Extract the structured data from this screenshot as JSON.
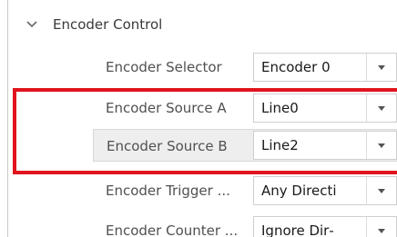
{
  "section": {
    "title": "Encoder Control",
    "expanded": true
  },
  "rows": [
    {
      "label": "Encoder Selector",
      "value": "Encoder 0"
    },
    {
      "label": "Encoder Source A",
      "value": "Line0"
    },
    {
      "label": "Encoder Source B",
      "value": "Line2"
    },
    {
      "label": "Encoder Trigger ...",
      "value": "Any Directi"
    },
    {
      "label": "Encoder Counter ...",
      "value": "Ignore Dir‐"
    }
  ],
  "icons": {
    "expand": "chevron-down-icon",
    "dropdown": "dropdown-caret-icon"
  },
  "colors": {
    "highlight_box": "#e0141e",
    "row_hover": "#eeeeee",
    "label_text": "#505050",
    "value_text": "#1a1a1a"
  }
}
